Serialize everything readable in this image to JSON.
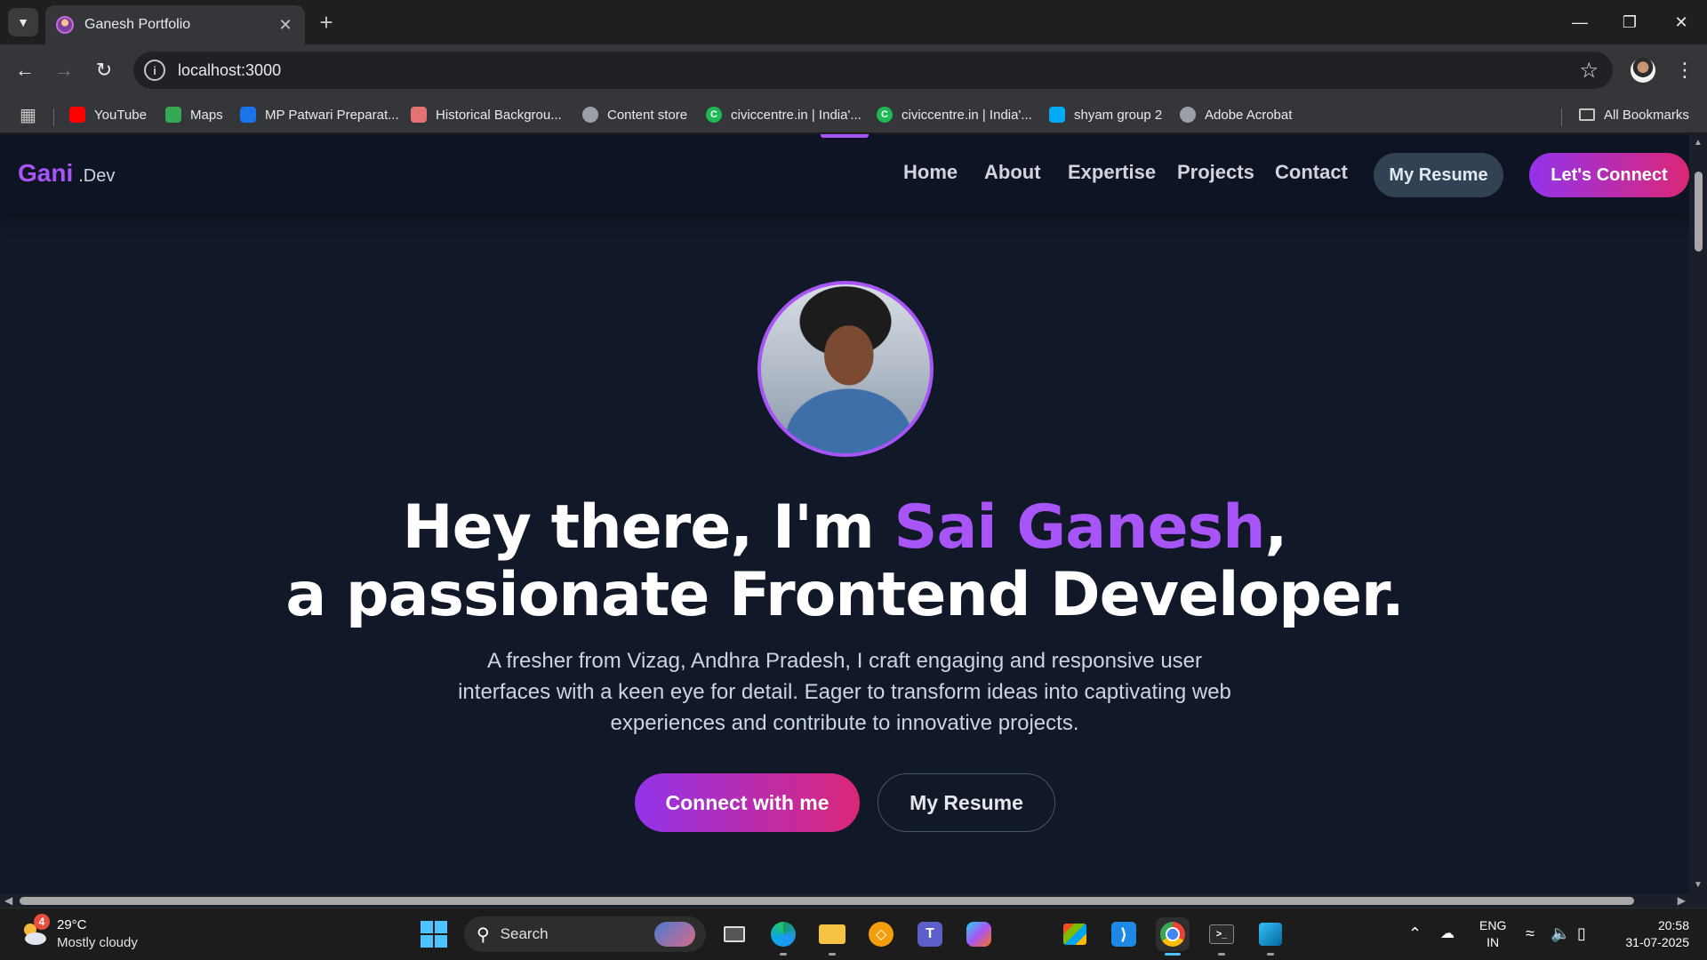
{
  "browser": {
    "tab_title": "Ganesh Portfolio",
    "url": "localhost:3000",
    "bookmarks": [
      {
        "label": "YouTube",
        "icon": "youtube-icon",
        "color": "#ff0000"
      },
      {
        "label": "Maps",
        "icon": "maps-icon",
        "color": "#34a853"
      },
      {
        "label": "MP Patwari Preparat...",
        "icon": "patwari-icon",
        "color": "#1a73e8"
      },
      {
        "label": "Historical Backgrou...",
        "icon": "historical-icon",
        "color": "#e57373"
      },
      {
        "label": "Content store",
        "icon": "globe-icon",
        "color": "#9aa0a6"
      },
      {
        "label": "civiccentre.in | India'...",
        "icon": "civiccentre-icon",
        "color": "#1db954"
      },
      {
        "label": "civiccentre.in | India'...",
        "icon": "civiccentre-icon",
        "color": "#1db954"
      },
      {
        "label": "shyam group 2",
        "icon": "shyam-icon",
        "color": "#03a9f4"
      },
      {
        "label": "Adobe Acrobat",
        "icon": "globe-icon",
        "color": "#9aa0a6"
      }
    ],
    "all_bookmarks_label": "All Bookmarks"
  },
  "site": {
    "logo_main": "Gani",
    "logo_sub": ".Dev",
    "nav": [
      "Home",
      "About",
      "Expertise",
      "Projects",
      "Contact"
    ],
    "resume_button": "My Resume",
    "connect_button": "Let's Connect",
    "accent_color": "#a855f7"
  },
  "hero": {
    "title_line1_prefix": "Hey there, I'm ",
    "title_name": "Sai Ganesh",
    "title_line1_suffix": ",",
    "title_line2": "a passionate Frontend Developer.",
    "description": "A fresher from Vizag, Andhra Pradesh, I craft engaging and responsive user interfaces with a keen eye for detail. Eager to transform ideas into captivating web experiences and contribute to innovative projects.",
    "primary_button": "Connect with me",
    "secondary_button": "My Resume"
  },
  "taskbar": {
    "weather_badge": "4",
    "temperature": "29°C",
    "condition": "Mostly cloudy",
    "search_label": "Search",
    "language_line1": "ENG",
    "language_line2": "IN",
    "time": "20:58",
    "date": "31-07-2025"
  }
}
